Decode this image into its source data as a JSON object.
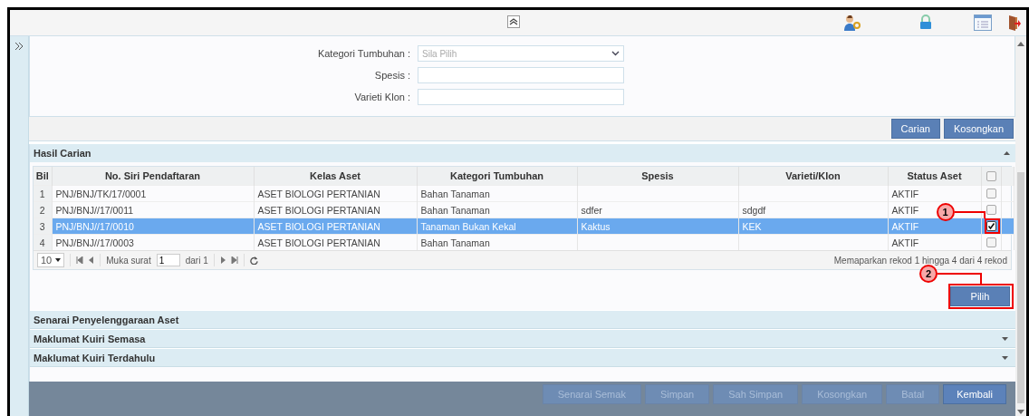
{
  "form": {
    "fields": [
      {
        "label": "Kategori Tumbuhan :",
        "kind": "select",
        "placeholder": "Sila Pilih"
      },
      {
        "label": "Spesis :",
        "kind": "text"
      },
      {
        "label": "Varieti Klon :",
        "kind": "text"
      }
    ],
    "buttons": [
      "Carian",
      "Kosongkan"
    ]
  },
  "results": {
    "title": "Hasil Carian",
    "expanded": true,
    "columns": [
      "Bil",
      "No. Siri Pendaftaran",
      "Kelas Aset",
      "Kategori Tumbuhan",
      "Spesis",
      "Varieti/Klon",
      "Status Aset"
    ],
    "header_checked": false,
    "rows": [
      {
        "cells": [
          "1",
          "PNJ/BNJ/TK/17/0001",
          "ASET BIOLOGI PERTANIAN",
          "Bahan Tanaman",
          "",
          "",
          "AKTIF"
        ],
        "selected": false,
        "checked": false
      },
      {
        "cells": [
          "2",
          "PNJ/BNJ//17/0011",
          "ASET BIOLOGI PERTANIAN",
          "Bahan Tanaman",
          "sdfer",
          "sdgdf",
          "AKTIF"
        ],
        "selected": false,
        "checked": false
      },
      {
        "cells": [
          "3",
          "PNJ/BNJ//17/0010",
          "ASET BIOLOGI PERTANIAN",
          "Tanaman Bukan Kekal",
          "Kaktus",
          "KEK",
          "AKTIF"
        ],
        "selected": true,
        "checked": true
      },
      {
        "cells": [
          "4",
          "PNJ/BNJ//17/0003",
          "ASET BIOLOGI PERTANIAN",
          "Bahan Tanaman",
          "",
          "",
          "AKTIF"
        ],
        "selected": false,
        "checked": false
      }
    ],
    "pager": {
      "page_size": "10",
      "page_label": "Muka surat",
      "page": "1",
      "of": "dari 1",
      "summary": "Memaparkan rekod 1 hingga 4 dari 4 rekod"
    },
    "select_button": "Pilih",
    "callouts": [
      "1",
      "2"
    ]
  },
  "sections": [
    {
      "title": "Senarai Penyelenggaraan Aset",
      "collapsible": false
    },
    {
      "title": "Maklumat Kuiri Semasa",
      "collapsible": true
    },
    {
      "title": "Maklumat Kuiri Terdahulu",
      "collapsible": true
    }
  ],
  "footer": [
    {
      "label": "Senarai Semak",
      "disabled": true
    },
    {
      "label": "Simpan",
      "disabled": true
    },
    {
      "label": "Sah Simpan",
      "disabled": true
    },
    {
      "label": "Kosongkan",
      "disabled": true
    },
    {
      "label": "Batal",
      "disabled": true
    },
    {
      "label": "Kembali",
      "disabled": false
    }
  ]
}
